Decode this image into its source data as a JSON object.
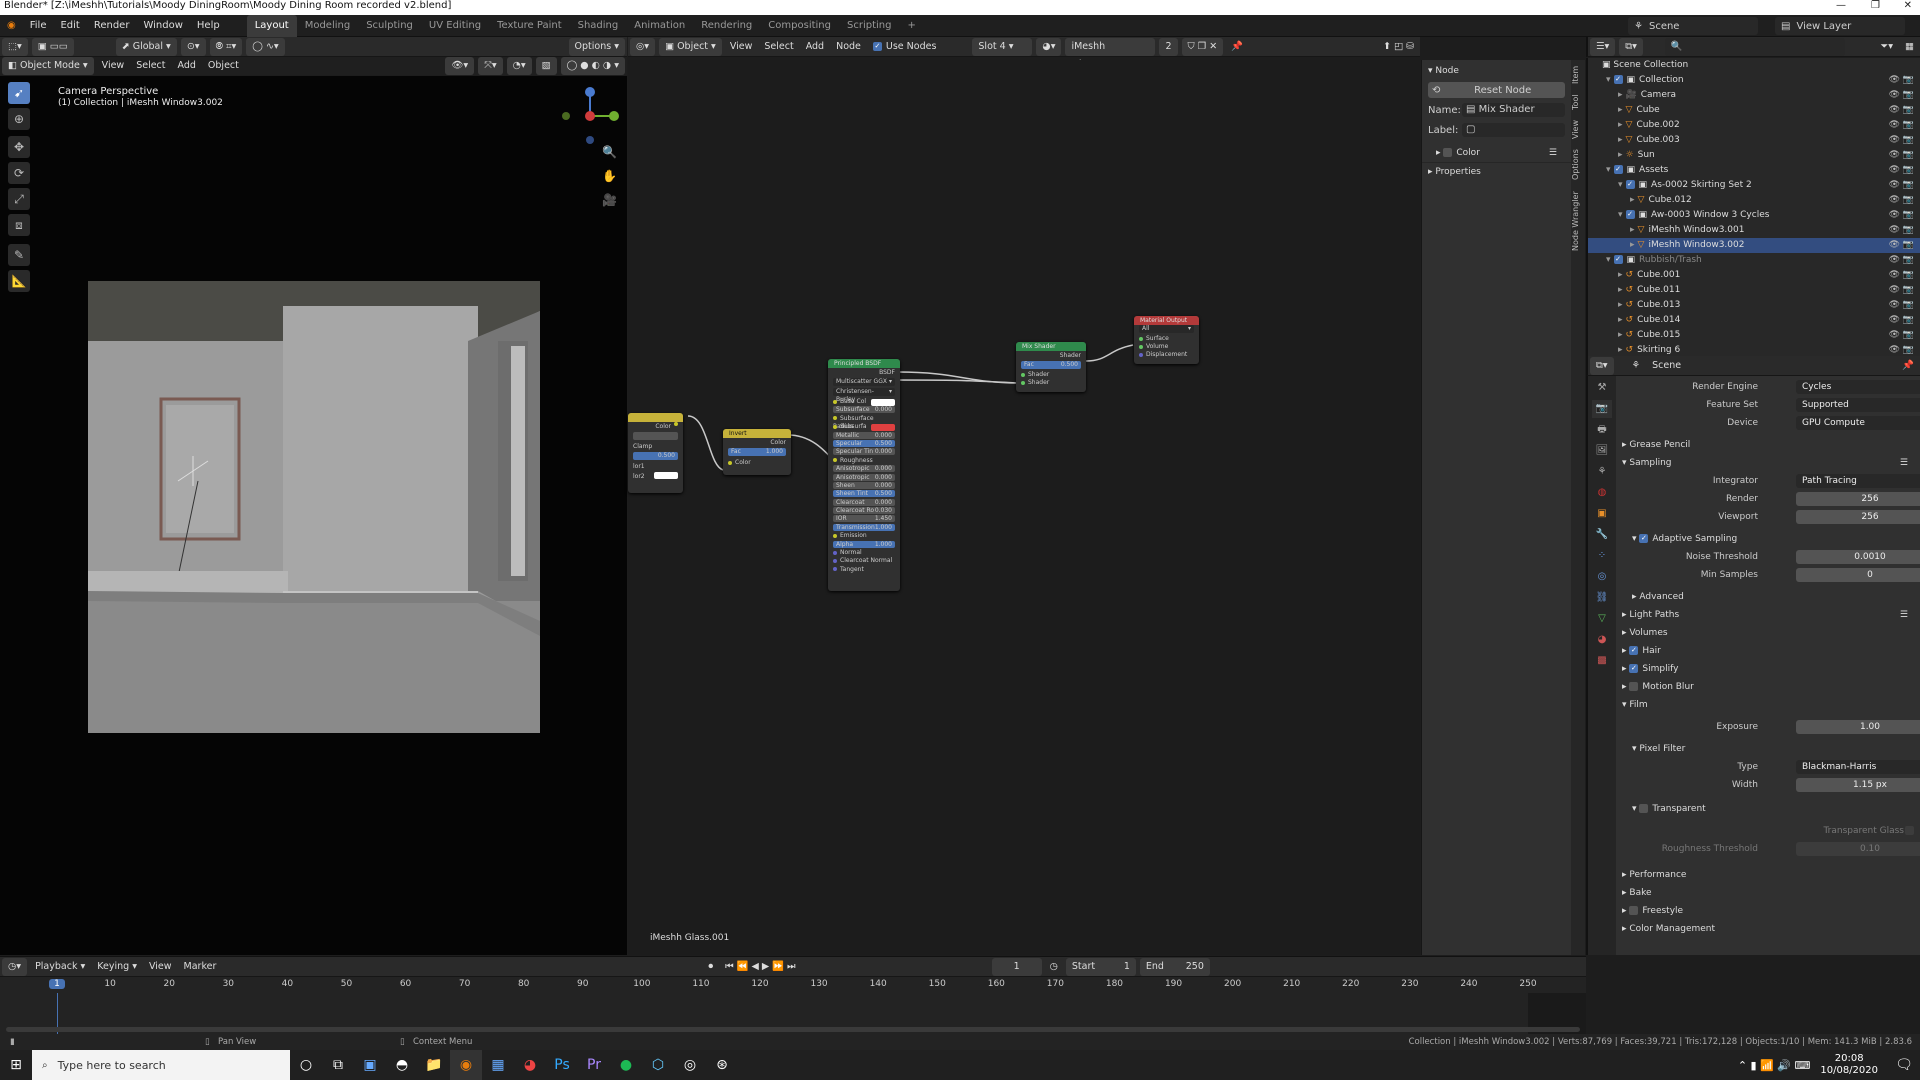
{
  "window": {
    "title": "Blender* [Z:\\iMeshh\\Tutorials\\Moody DiningRoom\\Moody Dining Room recorded v2.blend]"
  },
  "menu": [
    "File",
    "Edit",
    "Render",
    "Window",
    "Help"
  ],
  "workspaces": [
    "Layout",
    "Modeling",
    "Sculpting",
    "UV Editing",
    "Texture Paint",
    "Shading",
    "Animation",
    "Rendering",
    "Compositing",
    "Scripting"
  ],
  "active_workspace": "Layout",
  "scene_selector": "Scene",
  "view_layer": "View Layer",
  "viewport": {
    "mode": "Object Mode",
    "menu": [
      "View",
      "Select",
      "Add",
      "Object"
    ],
    "orientation": "Global",
    "options": "Options",
    "overlay_title": "Camera Perspective",
    "overlay_sub": "(1) Collection | iMeshh Window3.002"
  },
  "node_editor": {
    "type": "Object",
    "menu": [
      "View",
      "Select",
      "Add",
      "Node"
    ],
    "use_nodes": "Use Nodes",
    "slot": "Slot 4",
    "material": "iMeshh Glass.001",
    "users": "2",
    "footer_label": "iMeshh Glass.001",
    "nodes": {
      "material_output": {
        "title": "Material Output",
        "target": "All",
        "rows": [
          "Surface",
          "Volume",
          "Displacement"
        ]
      },
      "mix_shader": {
        "title": "Mix Shader",
        "out": "Shader",
        "fac_label": "Fac",
        "fac": "0.500",
        "rows": [
          "Shader",
          "Shader"
        ]
      },
      "principled": {
        "title": "Principled BSDF",
        "out": "BSDF",
        "dist": "Multiscatter GGX",
        "sss": "Christensen-Burley",
        "rows": [
          [
            "Base Col",
            ""
          ],
          [
            "Subsurface",
            "0.000"
          ],
          [
            "Subsurface Radius",
            ""
          ],
          [
            "Subsurfa",
            ""
          ],
          [
            "Metallic",
            "0.000"
          ],
          [
            "Specular",
            "0.500"
          ],
          [
            "Specular Tin",
            "0.000"
          ],
          [
            "Roughness",
            ""
          ],
          [
            "Anisotropic",
            "0.000"
          ],
          [
            "Anisotropic",
            "0.000"
          ],
          [
            "Sheen",
            "0.000"
          ],
          [
            "Sheen Tint",
            "0.500"
          ],
          [
            "Clearcoat",
            "0.000"
          ],
          [
            "Clearcoat Ro",
            "0.030"
          ],
          [
            "IOR",
            "1.450"
          ],
          [
            "Transmission",
            "1.000"
          ],
          [
            "Emission",
            ""
          ],
          [
            "Alpha",
            "1.000"
          ],
          [
            "Normal",
            ""
          ],
          [
            "Clearcoat Normal",
            ""
          ],
          [
            "Tangent",
            ""
          ]
        ]
      },
      "invert": {
        "title": "Invert",
        "out": "Color",
        "fac_label": "Fac",
        "fac": "1.000",
        "row": "Color"
      },
      "mix_left": {
        "title": "",
        "out": "Color",
        "clamp": "Clamp",
        "fac": "0.500",
        "c1": "lor1",
        "c2": "lor2"
      }
    }
  },
  "node_panel": {
    "header": "Node",
    "reset": "Reset Node",
    "name_label": "Name:",
    "name": "Mix Shader",
    "label_label": "Label:",
    "label": "",
    "color": "Color",
    "properties": "Properties",
    "tabs": [
      "Item",
      "Tool",
      "View",
      "Options",
      "Node Wrangler"
    ]
  },
  "outliner": {
    "root": "Scene Collection",
    "rows": [
      {
        "indent": 1,
        "name": "Collection",
        "type": "coll"
      },
      {
        "indent": 2,
        "name": "Camera",
        "type": "cam"
      },
      {
        "indent": 2,
        "name": "Cube",
        "type": "mesh"
      },
      {
        "indent": 2,
        "name": "Cube.002",
        "type": "mesh"
      },
      {
        "indent": 2,
        "name": "Cube.003",
        "type": "mesh"
      },
      {
        "indent": 2,
        "name": "Sun",
        "type": "light"
      },
      {
        "indent": 1,
        "name": "Assets",
        "type": "coll"
      },
      {
        "indent": 2,
        "name": "As-0002 Skirting Set 2",
        "type": "coll"
      },
      {
        "indent": 3,
        "name": "Cube.012",
        "type": "mesh"
      },
      {
        "indent": 2,
        "name": "Aw-0003 Window 3 Cycles",
        "type": "coll"
      },
      {
        "indent": 3,
        "name": "iMeshh Window3.001",
        "type": "mesh"
      },
      {
        "indent": 3,
        "name": "iMeshh Window3.002",
        "type": "mesh",
        "selected": true
      },
      {
        "indent": 1,
        "name": "Rubbish/Trash",
        "type": "coll",
        "dim": true
      },
      {
        "indent": 2,
        "name": "Cube.001",
        "type": "hook"
      },
      {
        "indent": 2,
        "name": "Cube.011",
        "type": "hook"
      },
      {
        "indent": 2,
        "name": "Cube.013",
        "type": "hook"
      },
      {
        "indent": 2,
        "name": "Cube.014",
        "type": "hook"
      },
      {
        "indent": 2,
        "name": "Cube.015",
        "type": "hook"
      },
      {
        "indent": 2,
        "name": "Skirting 6",
        "type": "hook"
      }
    ]
  },
  "properties": {
    "context": "Scene",
    "render_engine_label": "Render Engine",
    "render_engine": "Cycles",
    "feature_set_label": "Feature Set",
    "feature_set": "Supported",
    "device_label": "Device",
    "device": "GPU Compute",
    "grease_pencil": "Grease Pencil",
    "sampling": "Sampling",
    "integrator_label": "Integrator",
    "integrator": "Path Tracing",
    "render_label": "Render",
    "render": "256",
    "viewport_label": "Viewport",
    "viewport": "256",
    "adaptive": "Adaptive Sampling",
    "noise_label": "Noise Threshold",
    "noise": "0.0010",
    "min_label": "Min Samples",
    "min": "0",
    "advanced": "Advanced",
    "light_paths": "Light Paths",
    "volumes": "Volumes",
    "hair": "Hair",
    "simplify": "Simplify",
    "motion_blur": "Motion Blur",
    "film": "Film",
    "exposure_label": "Exposure",
    "exposure": "1.00",
    "pixel_filter": "Pixel Filter",
    "type_label": "Type",
    "type": "Blackman-Harris",
    "width_label": "Width",
    "width": "1.15 px",
    "transparent": "Transparent",
    "transparent_glass": "Transparent Glass",
    "roughness_label": "Roughness Threshold",
    "roughness": "0.10",
    "performance": "Performance",
    "bake": "Bake",
    "freestyle": "Freestyle",
    "color_management": "Color Management"
  },
  "timeline": {
    "menu": [
      "Playback",
      "Keying",
      "View",
      "Marker"
    ],
    "current": "1",
    "start_label": "Start",
    "start": "1",
    "end_label": "End",
    "end": "250",
    "ticks": [
      "1",
      "10",
      "20",
      "30",
      "40",
      "50",
      "60",
      "70",
      "80",
      "90",
      "100",
      "110",
      "120",
      "130",
      "140",
      "150",
      "160",
      "170",
      "180",
      "190",
      "200",
      "210",
      "220",
      "230",
      "240",
      "250"
    ]
  },
  "status": {
    "pan": "Pan View",
    "context": "Context Menu",
    "stats": "Collection | iMeshh Window3.002 | Verts:87,769 | Faces:39,721 | Tris:172,128 | Objects:1/10 | Mem: 141.3 MiB | 2.83.6"
  },
  "taskbar": {
    "search": "Type here to search",
    "time": "20:08",
    "date": "10/08/2020"
  }
}
